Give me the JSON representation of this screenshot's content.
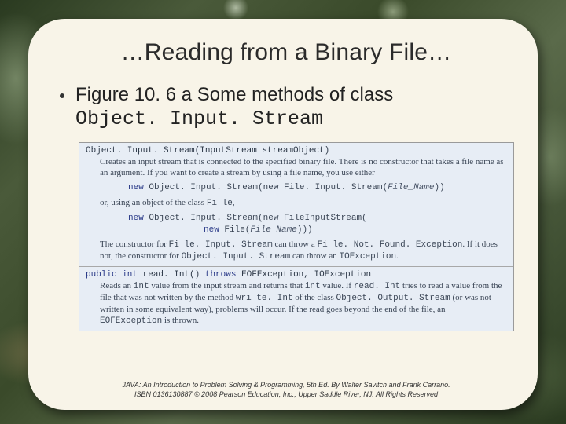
{
  "title": "…Reading from a Binary File…",
  "bullet": {
    "lead": "Figure 10. 6 a  Some methods of class ",
    "class_name": "Object. Input. Stream"
  },
  "figure": {
    "sec1": {
      "signature": "Object. Input. Stream(InputStream streamObject)",
      "body_a": "Creates an input stream that is connected to the specified binary file. There is no constructor that takes a file name as an argument. If you want to create a stream by using a file name, you use either",
      "code1_pre": "new ",
      "code1_mid": "Object. Input. Stream(new  File. Input. Stream(",
      "code1_arg": "File_Name",
      "code1_end": "))",
      "body_b": "or, using an object of the class ",
      "body_b_mono": "Fi le",
      "body_b_tail": ",",
      "code2_pre": "new ",
      "code2_mid": "Object. Input. Stream(new  FileInputStream(",
      "code2_line2_pre": "new ",
      "code2_line2_mid": "File(",
      "code2_line2_arg": "File_Name",
      "code2_line2_end": ")))",
      "body_c_a": "The constructor for ",
      "body_c_m1": "Fi le. Input. Stream",
      "body_c_b": " can throw a ",
      "body_c_m2": "Fi le. Not. Found. Exception",
      "body_c_c": ". If it does not, the constructor for ",
      "body_c_m3": "Object. Input. Stream",
      "body_c_d": " can throw an ",
      "body_c_m4": "IOException",
      "body_c_e": "."
    },
    "sec2": {
      "sig_a": "public int ",
      "sig_b": "read. Int() ",
      "sig_c": "throws ",
      "sig_d": "EOFException, IOException",
      "body_a": "Reads an ",
      "body_m1": "int",
      "body_b": " value from the input stream and returns that ",
      "body_m2": "int",
      "body_c": " value. If ",
      "body_m3": "read. Int",
      "body_d": " tries to read a value from the file that was not written by the method ",
      "body_m4": "wri te. Int",
      "body_e": " of the class ",
      "body_m5": "Object. Output. Stream",
      "body_f": " (or was not written in some equivalent way), problems will occur. If the read goes beyond the end of the file, an ",
      "body_m6": "EOFException",
      "body_g": " is thrown."
    }
  },
  "footer": {
    "line1": "JAVA: An Introduction to Problem Solving & Programming, 5th Ed. By Walter Savitch and Frank Carrano.",
    "line2": "ISBN 0136130887 © 2008 Pearson Education, Inc., Upper Saddle River, NJ. All Rights Reserved"
  }
}
